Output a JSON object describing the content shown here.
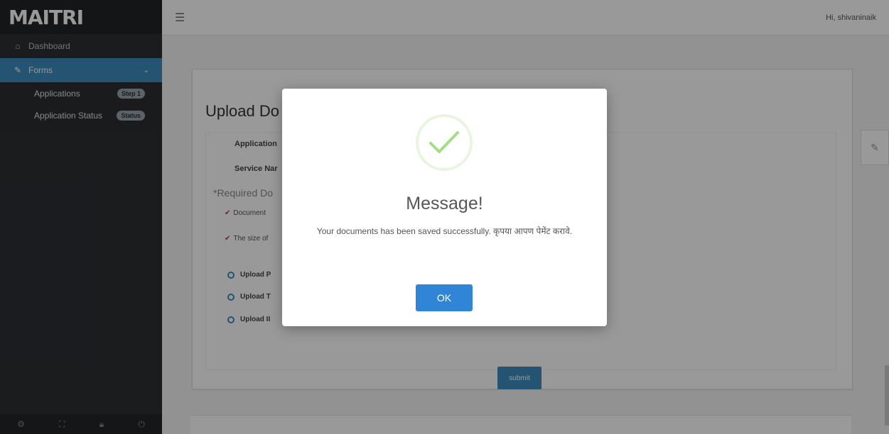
{
  "brand": "MAITRI",
  "sidebar": {
    "items": [
      {
        "label": "Dashboard",
        "icon": "home-icon"
      },
      {
        "label": "Forms",
        "icon": "edit-icon"
      }
    ],
    "sub_items": [
      {
        "label": "Applications",
        "badge": "Step 1"
      },
      {
        "label": "Application Status",
        "badge": "Status"
      }
    ]
  },
  "topbar": {
    "greeting": "Hi, shivaninaik"
  },
  "page": {
    "title": "Upload Do",
    "fields": [
      "Application",
      "Service Nar"
    ],
    "required_title": "*Required Do",
    "required_items": [
      "Document",
      "The size of"
    ],
    "uploads": [
      "Upload P",
      "Upload T",
      "Upload II"
    ],
    "submit_label": "submit"
  },
  "modal": {
    "title": "Message!",
    "text": "Your documents has been saved successfully. कृपया आपण पेमेंट करावे.",
    "ok_label": "OK"
  },
  "colors": {
    "accent": "#3c8dbc",
    "success": "#a5dc86",
    "ok_button": "#3085d6"
  }
}
